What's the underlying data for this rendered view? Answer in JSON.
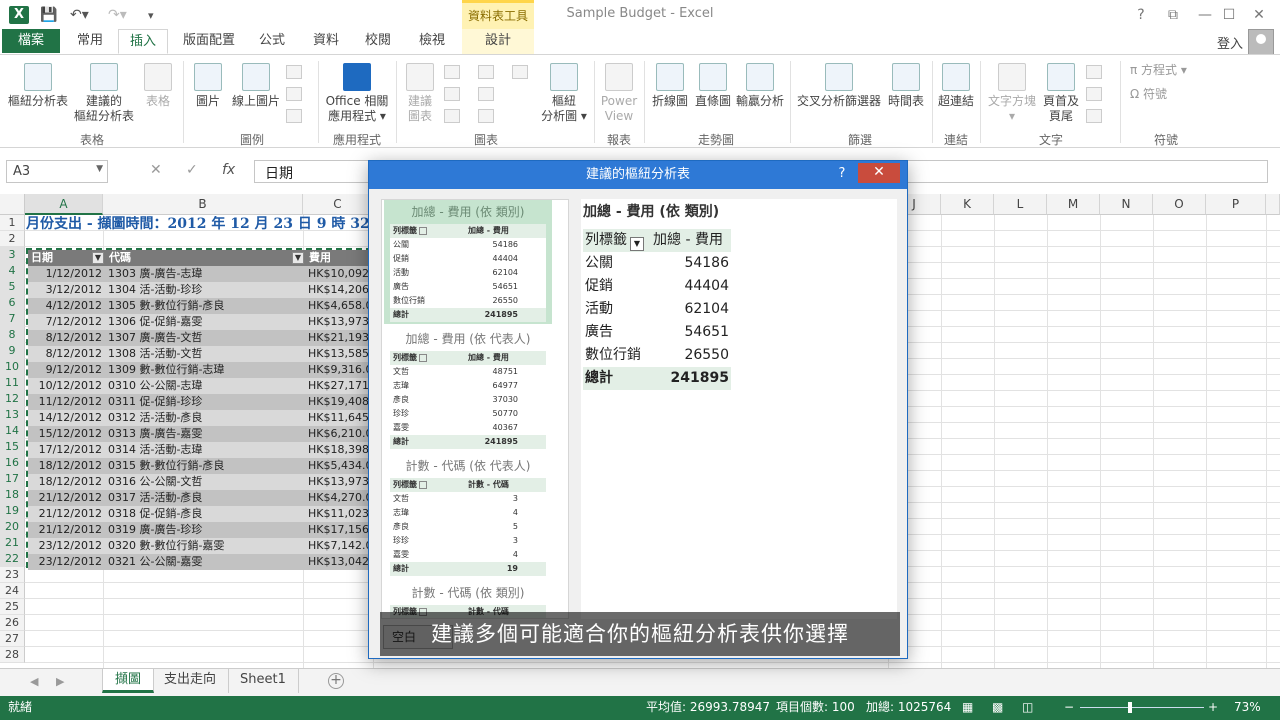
{
  "window": {
    "title": "Sample Budget - Excel",
    "context_tab_title": "資料表工具",
    "controls": {
      "help": "?",
      "ribbon_display": "⧉",
      "minimize": "—",
      "maximize": "☐",
      "close": "✕"
    }
  },
  "qat": {
    "save_icon": "save-icon",
    "undo_icon": "undo-icon",
    "redo_icon": "redo-icon"
  },
  "tabs": [
    {
      "label": "檔案"
    },
    {
      "label": "常用"
    },
    {
      "label": "插入"
    },
    {
      "label": "版面配置"
    },
    {
      "label": "公式"
    },
    {
      "label": "資料"
    },
    {
      "label": "校閱"
    },
    {
      "label": "檢視"
    },
    {
      "label": "設計"
    }
  ],
  "signin": "登入",
  "ribbon": {
    "buttons": {
      "pivot": "樞紐分析表",
      "recommended_pivot_1": "建議的",
      "recommended_pivot_2": "樞紐分析表",
      "table": "表格",
      "pictures": "圖片",
      "online_pictures": "線上圖片",
      "office_apps_1": "Office 相關",
      "office_apps_2": "應用程式 ▾",
      "recommended_charts_1": "建議",
      "recommended_charts_2": "圖表",
      "pivot_chart_1": "樞紐",
      "pivot_chart_2": "分析圖 ▾",
      "power_view_1": "Power",
      "power_view_2": "View",
      "line": "折線圖",
      "column": "直條圖",
      "win_loss": "輸贏分析",
      "slicer": "交叉分析篩選器",
      "timeline": "時間表",
      "hyperlink": "超連結",
      "textbox_1": "文字方塊",
      "textbox_2": "▾",
      "header_footer_1": "頁首及",
      "header_footer_2": "頁尾",
      "equation": "π 方程式 ▾",
      "symbol": "Ω 符號"
    },
    "groups": [
      "表格",
      "圖例",
      "應用程式",
      "圖表",
      "報表",
      "走勢圖",
      "篩選",
      "連結",
      "文字",
      "符號"
    ]
  },
  "formula_bar": {
    "name_box": "A3",
    "cancel": "✕",
    "enter": "✓",
    "fx": "fx",
    "value": "日期"
  },
  "columns": [
    "A",
    "B",
    "C",
    "J",
    "K",
    "L",
    "M",
    "N",
    "O",
    "P"
  ],
  "rows": [
    "1",
    "2",
    "3",
    "4",
    "5",
    "6",
    "7",
    "8",
    "9",
    "10",
    "11",
    "12",
    "13",
    "14",
    "15",
    "16",
    "17",
    "18",
    "19",
    "20",
    "21",
    "22",
    "23",
    "24",
    "25",
    "26",
    "27",
    "28"
  ],
  "sheet": {
    "title_row": "月份支出 - 擷圖時間：2012 年 12 月 23 日 9 時 32 分",
    "headers": [
      "日期",
      "代碼",
      "費用"
    ],
    "data": [
      [
        "1/12/2012",
        "1303 廣-廣告-志瑋",
        "HK$10,092.00"
      ],
      [
        "3/12/2012",
        "1304 活-活動-珍珍",
        "HK$14,206.00"
      ],
      [
        "4/12/2012",
        "1305 數-數位行銷-彥良",
        "HK$4,658.00"
      ],
      [
        "7/12/2012",
        "1306 促-促銷-嘉雯",
        "HK$13,973.00"
      ],
      [
        "8/12/2012",
        "1307 廣-廣告-文哲",
        "HK$21,193.00"
      ],
      [
        "8/12/2012",
        "1308 活-活動-文哲",
        "HK$13,585.00"
      ],
      [
        "9/12/2012",
        "1309 數-數位行銷-志瑋",
        "HK$9,316.00"
      ],
      [
        "10/12/2012",
        "0310 公-公關-志瑋",
        "HK$27,171.00"
      ],
      [
        "11/12/2012",
        "0311 促-促銷-珍珍",
        "HK$19,408.00"
      ],
      [
        "14/12/2012",
        "0312 活-活動-彥良",
        "HK$11,645.00"
      ],
      [
        "15/12/2012",
        "0313 廣-廣告-嘉雯",
        "HK$6,210.00"
      ],
      [
        "17/12/2012",
        "0314 活-活動-志瑋",
        "HK$18,398.00"
      ],
      [
        "18/12/2012",
        "0315 數-數位行銷-彥良",
        "HK$5,434.00"
      ],
      [
        "18/12/2012",
        "0316 公-公關-文哲",
        "HK$13,973.00"
      ],
      [
        "21/12/2012",
        "0317 活-活動-彥良",
        "HK$4,270.00"
      ],
      [
        "21/12/2012",
        "0318 促-促銷-彥良",
        "HK$11,023.00"
      ],
      [
        "21/12/2012",
        "0319 廣-廣告-珍珍",
        "HK$17,156.00"
      ],
      [
        "23/12/2012",
        "0320 數-數位行銷-嘉雯",
        "HK$7,142.00"
      ],
      [
        "23/12/2012",
        "0321 公-公關-嘉雯",
        "HK$13,042.00"
      ]
    ]
  },
  "sheet_tabs": [
    "擷圖",
    "支出走向",
    "Sheet1"
  ],
  "status": {
    "ready": "就緒",
    "average": "平均值: 26993.78947",
    "count": "項目個數: 100",
    "sum": "加總: 1025764",
    "zoom": "73%"
  },
  "dialog": {
    "title": "建議的樞紐分析表",
    "help": "?",
    "close": "✕",
    "row_label_header": "列標籤",
    "options": [
      {
        "title": "加總 - 費用 (依 類別)",
        "value_header": "加總 - 費用",
        "rows": [
          [
            "公關",
            "54186"
          ],
          [
            "促銷",
            "44404"
          ],
          [
            "活動",
            "62104"
          ],
          [
            "廣告",
            "54651"
          ],
          [
            "數位行銷",
            "26550"
          ]
        ],
        "total_label": "總計",
        "total": "241895"
      },
      {
        "title": "加總 - 費用 (依 代表人)",
        "value_header": "加總 - 費用",
        "rows": [
          [
            "文哲",
            "48751"
          ],
          [
            "志瑋",
            "64977"
          ],
          [
            "彥良",
            "37030"
          ],
          [
            "珍珍",
            "50770"
          ],
          [
            "嘉雯",
            "40367"
          ]
        ],
        "total_label": "總計",
        "total": "241895"
      },
      {
        "title": "計數 - 代碼 (依 代表人)",
        "value_header": "計數 - 代碼",
        "rows": [
          [
            "文哲",
            "3"
          ],
          [
            "志瑋",
            "4"
          ],
          [
            "彥良",
            "5"
          ],
          [
            "珍珍",
            "3"
          ],
          [
            "嘉雯",
            "4"
          ]
        ],
        "total_label": "總計",
        "total": "19"
      },
      {
        "title": "計數 - 代碼 (依 類別)",
        "value_header": "計數 - 代碼",
        "rows": [],
        "total_label": "",
        "total": ""
      }
    ],
    "preview": {
      "title": "加總 - 費用 (依 類別)",
      "value_header": "加總 - 費用",
      "rows": [
        [
          "公關",
          "54186"
        ],
        [
          "促銷",
          "44404"
        ],
        [
          "活動",
          "62104"
        ],
        [
          "廣告",
          "54651"
        ],
        [
          "數位行銷",
          "26550"
        ]
      ],
      "total_label": "總計",
      "total": "241895"
    },
    "blank_pivot_button": "空白"
  },
  "caption": "建議多個可能適合你的樞紐分析表供你選擇"
}
